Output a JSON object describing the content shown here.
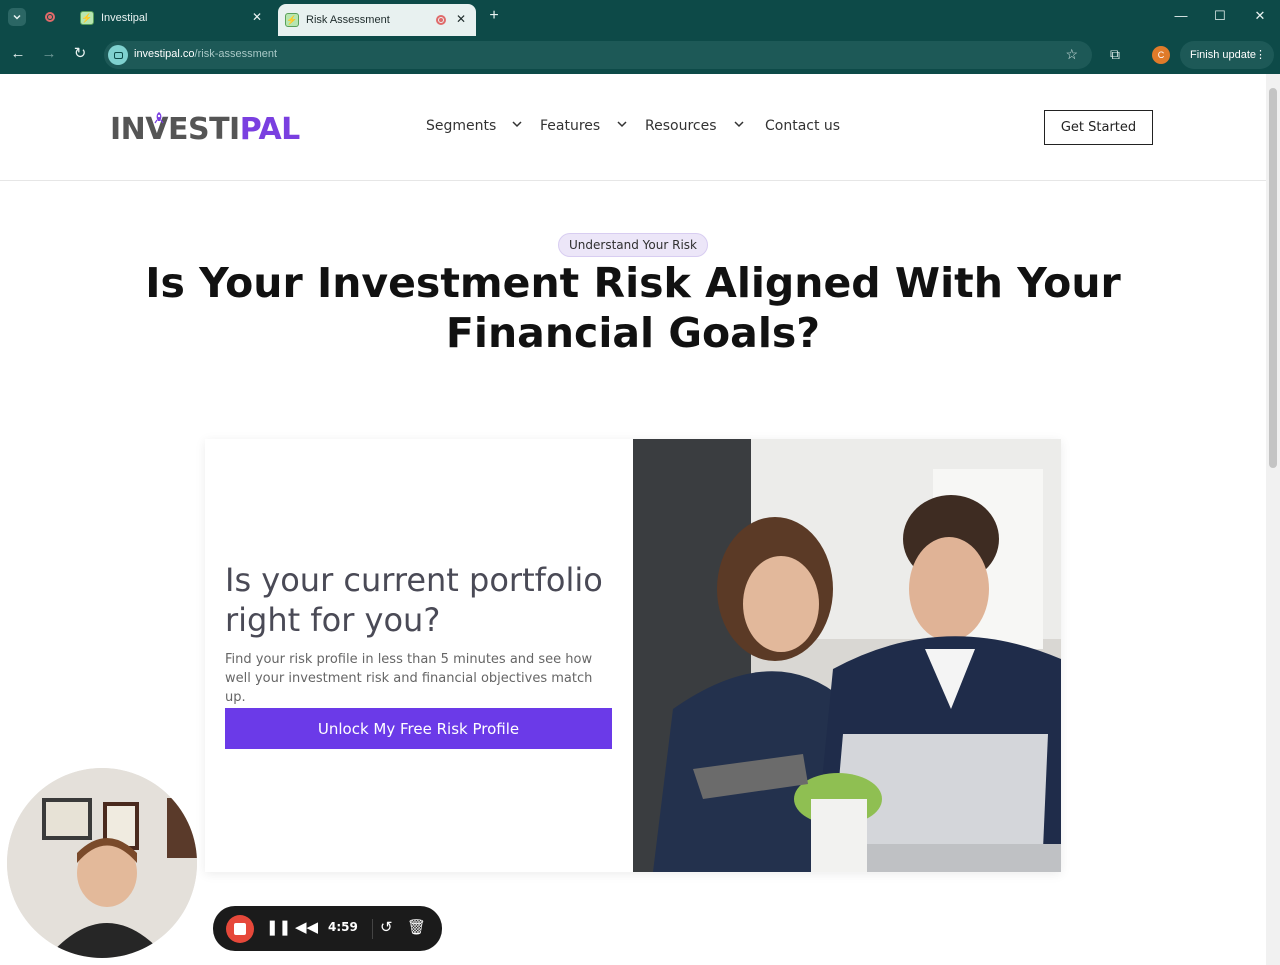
{
  "browser": {
    "tabs": [
      {
        "title": "Investipal",
        "active": false
      },
      {
        "title": "Risk Assessment",
        "active": true
      }
    ],
    "url_host": "investipal.co",
    "url_path": "/risk-assessment",
    "profile_initial": "C",
    "finish_update_label": "Finish update"
  },
  "header": {
    "logo_part1": "INVESTI",
    "logo_part2": "PAL",
    "nav": [
      "Segments",
      "Features",
      "Resources",
      "Contact us"
    ],
    "cta_label": "Get Started"
  },
  "hero": {
    "eyebrow": "Understand Your Risk",
    "headline": "Is Your Investment Risk Aligned With Your Financial Goals?"
  },
  "card": {
    "title": "Is your current portfolio right for you?",
    "text": "Find your risk profile in less than 5 minutes and see how well your investment risk and financial objectives match up.",
    "button_label": "Unlock My Free Risk Profile"
  },
  "recorder": {
    "timer": "4:59"
  },
  "colors": {
    "brand_purple": "#6b3ae8",
    "logo_gray": "#555555",
    "chrome_teal": "#0d4a48"
  }
}
